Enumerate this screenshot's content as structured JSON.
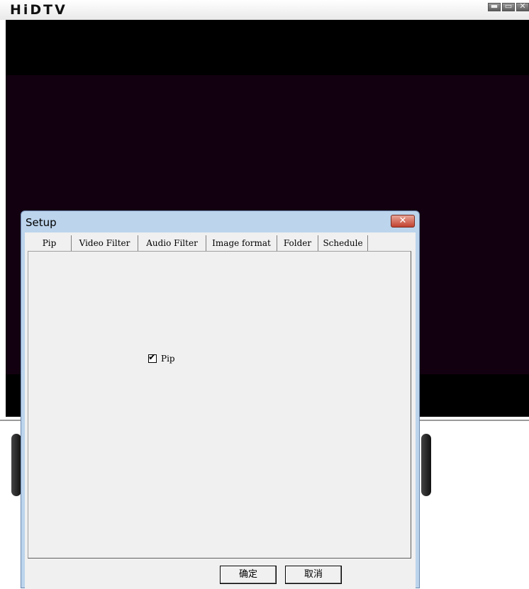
{
  "app": {
    "title": "HiDTV",
    "controls": {
      "minimize": "▬",
      "maximize": "▭",
      "close": "✕"
    }
  },
  "dialog": {
    "title": "Setup",
    "close_glyph": "✕",
    "tabs": [
      {
        "label": "Pip",
        "active": true
      },
      {
        "label": "Video Filter",
        "active": false
      },
      {
        "label": "Audio Filter",
        "active": false
      },
      {
        "label": "Image format",
        "active": false
      },
      {
        "label": "Folder",
        "active": false
      },
      {
        "label": "Schedule",
        "active": false
      }
    ],
    "pip_checkbox": {
      "label": "Pip",
      "checked": true,
      "check_glyph": "✔"
    },
    "ok_label": "确定",
    "cancel_label": "取消"
  },
  "colors": {
    "video_background": "#120010",
    "dialog_frame": "#bcd4ec",
    "close_button": "#c2412f"
  }
}
